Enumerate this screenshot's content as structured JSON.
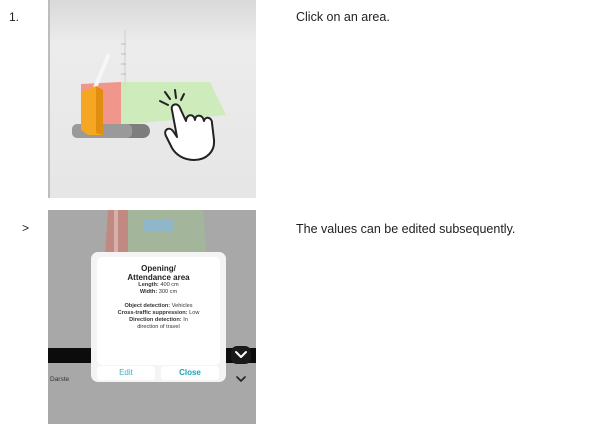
{
  "steps": [
    {
      "number": "1.",
      "instruction": "Click on an area."
    },
    {
      "number": ">",
      "instruction": "The values can be edited subsequently."
    }
  ],
  "dialog": {
    "title_line1": "Opening/",
    "title_line2": "Attendance area",
    "length_label": "Length:",
    "length_value": "400 cm",
    "width_label": "Width:",
    "width_value": "300 cm",
    "object_detection_label": "Object detection:",
    "object_detection_value": "Vehicles",
    "cross_traffic_label": "Cross-traffic suppression:",
    "cross_traffic_value": "Low",
    "direction_label": "Direction detection:",
    "direction_value_1": "In",
    "direction_value_2": "direction of travel",
    "edit_label": "Edit",
    "close_label": "Close"
  },
  "background_label": "Darste",
  "colors": {
    "accent": "#1aa3b3",
    "green_area": "#c9ebb4",
    "red_area": "#f0968a",
    "orange_device": "#f5a623"
  },
  "icons": [
    "tap-hand-icon",
    "chevron-down-icon"
  ]
}
